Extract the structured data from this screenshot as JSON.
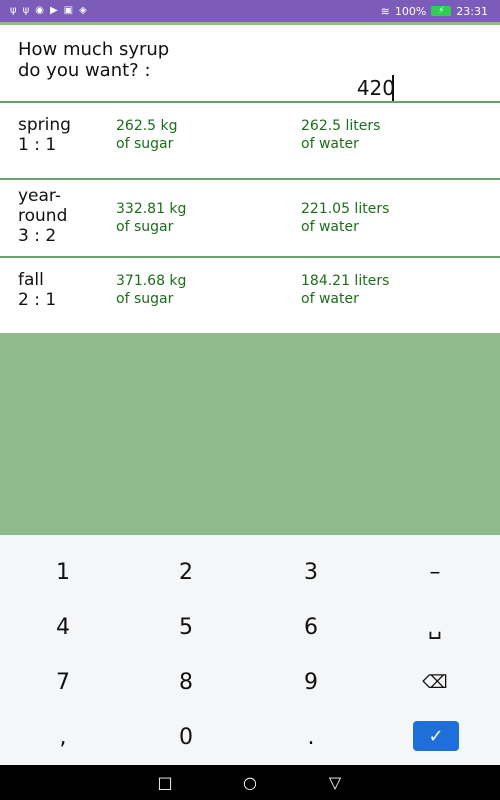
{
  "status_bar": {
    "left_icons": [
      "usb-icon",
      "usb-icon",
      "vpn-icon",
      "youtube-icon",
      "gallery-icon",
      "app-icon"
    ],
    "battery": "100%",
    "time": "23:31"
  },
  "question": {
    "line1": "How much syrup",
    "line2": "do you want? :",
    "amount": "420"
  },
  "rows": [
    {
      "season": "spring",
      "ratio": "1 : 1",
      "sugar_amount": "262.5 kg",
      "sugar_label": "of sugar",
      "water_amount": "262.5 liters",
      "water_label": "of water"
    },
    {
      "season_line1": "year-",
      "season_line2": "round",
      "ratio": "3 : 2",
      "sugar_amount": "332.81 kg",
      "sugar_label": "of sugar",
      "water_amount": "221.05 liters",
      "water_label": "of water"
    },
    {
      "season": "fall",
      "ratio": "2 : 1",
      "sugar_amount": "371.68 kg",
      "sugar_label": "of sugar",
      "water_amount": "184.21 liters",
      "water_label": "of water"
    }
  ],
  "keyboard": {
    "keys": [
      "1",
      "2",
      "3",
      "–",
      "4",
      "5",
      "6",
      "␣",
      "7",
      "8",
      "9",
      "⌫",
      ",",
      "0",
      ".",
      "✓"
    ]
  },
  "nav": {
    "recent_icon": "recent-apps-icon",
    "home_icon": "home-icon",
    "back_icon": "back-icon"
  }
}
